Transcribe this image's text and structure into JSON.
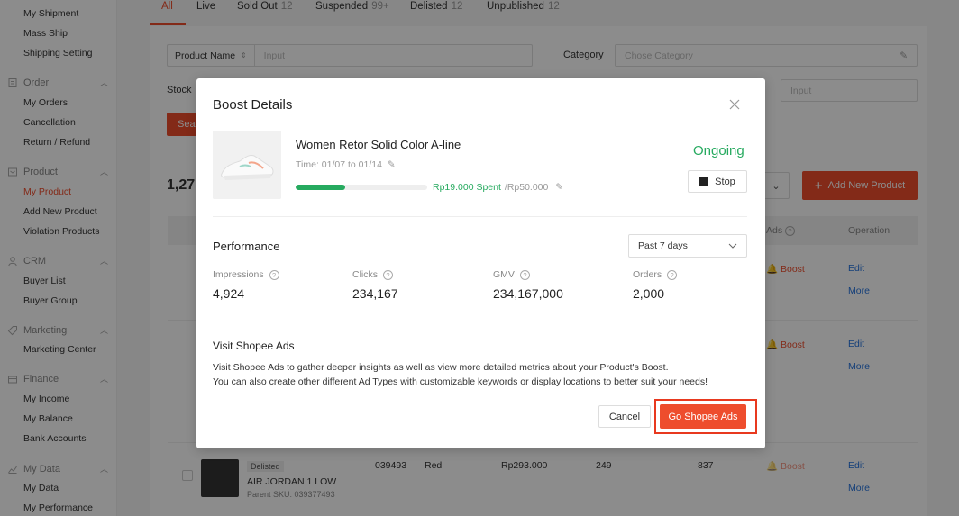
{
  "sidebar": {
    "items_top": [
      "My Shipment",
      "Mass Ship",
      "Shipping Setting"
    ],
    "groups": [
      {
        "title": "Order",
        "icon": "order-icon",
        "items": [
          "My Orders",
          "Cancellation",
          "Return / Refund"
        ]
      },
      {
        "title": "Product",
        "icon": "product-icon",
        "items": [
          "My Product",
          "Add New Product",
          "Violation Products"
        ],
        "active": "My Product"
      },
      {
        "title": "CRM",
        "icon": "crm-icon",
        "items": [
          "Buyer List",
          "Buyer Group"
        ]
      },
      {
        "title": "Marketing",
        "icon": "marketing-icon",
        "items": [
          "Marketing Center"
        ]
      },
      {
        "title": "Finance",
        "icon": "finance-icon",
        "items": [
          "My Income",
          "My Balance",
          "Bank Accounts"
        ]
      },
      {
        "title": "My Data",
        "icon": "data-icon",
        "items": [
          "My Data",
          "My Performance"
        ]
      }
    ]
  },
  "tabs": [
    {
      "label": "All",
      "count": ""
    },
    {
      "label": "Live",
      "count": ""
    },
    {
      "label": "Sold Out",
      "count": "12"
    },
    {
      "label": "Suspended",
      "count": "99+"
    },
    {
      "label": "Delisted",
      "count": "12"
    },
    {
      "label": "Unpublished",
      "count": "12"
    }
  ],
  "filters": {
    "product_name_label": "Product Name",
    "product_name_placeholder": "Input",
    "category_label": "Category",
    "category_placeholder": "Chose Category",
    "stock_label": "Stock",
    "stock_placeholder": "Input",
    "search_btn_partial": "Sea"
  },
  "list": {
    "count_partial": "1,27",
    "add_new_product": "Add New Product",
    "col_ads": "Ads",
    "col_operation": "Operation",
    "boost": "Boost",
    "edit": "Edit",
    "more": "More",
    "last_row": {
      "status": "Delisted",
      "name": "AIR JORDAN 1 LOW",
      "parent_sku": "Parent SKU: 039377493",
      "sku": "039493",
      "variation": "Red",
      "price": "Rp293.000",
      "stock": "249",
      "sales": "837"
    }
  },
  "modal": {
    "title": "Boost Details",
    "product_name": "Women Retor Solid Color A-line",
    "time": "Time: 01/07 to 01/14",
    "progress": 0.38,
    "spent": "Rp19.000 Spent",
    "budget": "/Rp50.000",
    "status": "Ongoing",
    "stop_label": "Stop",
    "performance_title": "Performance",
    "period": "Past 7 days",
    "metrics": [
      {
        "label": "Impressions",
        "value": "4,924"
      },
      {
        "label": "Clicks",
        "value": "234,167"
      },
      {
        "label": "GMV",
        "value": "234,167,000"
      },
      {
        "label": "Orders",
        "value": "2,000"
      }
    ],
    "visit_title": "Visit Shopee Ads",
    "visit_desc_1": "Visit Shopee Ads to gather deeper insights as well as view more detailed metrics about your Product's Boost.",
    "visit_desc_2": "You can also create other different Ad Types with customizable keywords or display locations to better suit your needs!",
    "cancel_label": "Cancel",
    "go_label": "Go Shopee Ads"
  },
  "colors": {
    "accent": "#ee4d2d",
    "success": "#26aa5f",
    "link": "#2673dd"
  }
}
